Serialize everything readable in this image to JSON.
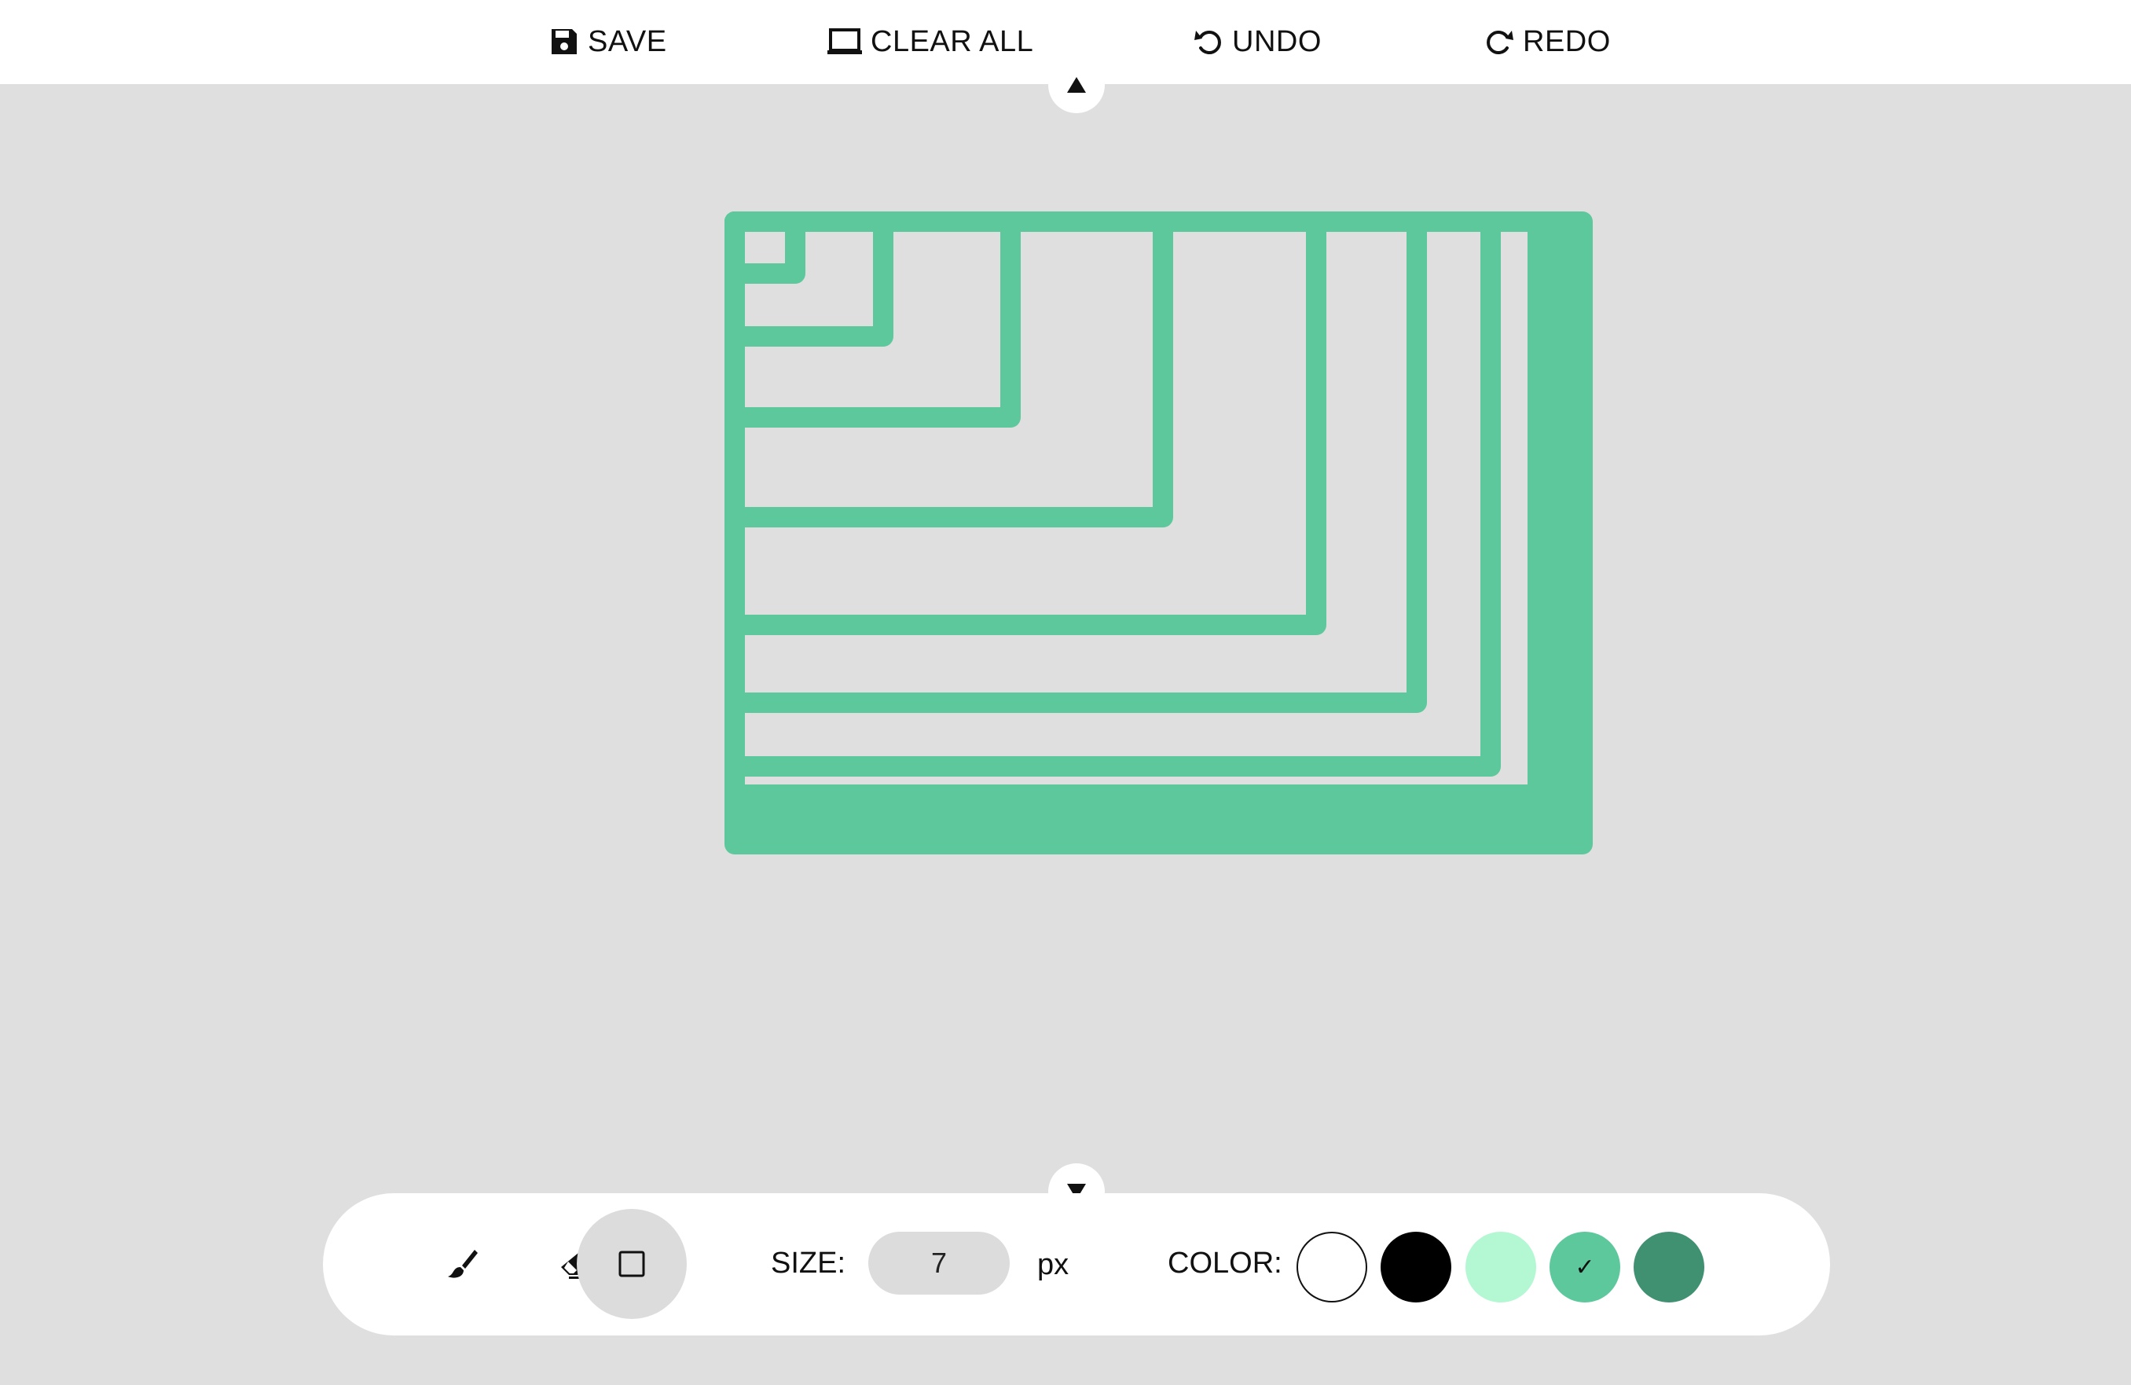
{
  "topbar": {
    "save_label": "SAVE",
    "clear_label": "CLEAR ALL",
    "undo_label": "UNDO",
    "redo_label": "REDO"
  },
  "toolbar": {
    "tools": [
      "brush",
      "eraser",
      "rectangle"
    ],
    "active_tool": "rectangle",
    "size_label": "SIZE:",
    "size_value": "7",
    "size_unit": "px",
    "color_label": "COLOR:",
    "colors": [
      "#ffffff",
      "#000000",
      "#b3f8d2",
      "#5dc89b",
      "#409072"
    ],
    "selected_color_index": 3,
    "check_mark": "✓"
  },
  "canvas": {
    "stroke_color": "#5dc89b"
  }
}
